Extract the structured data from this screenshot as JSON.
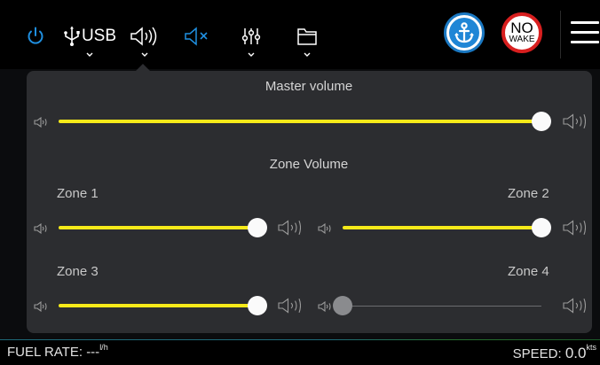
{
  "topbar": {
    "source_label": "USB",
    "colors": {
      "accent": "#1f8fe0",
      "icon": "#ffffff"
    }
  },
  "badges": {
    "anchor": {
      "icon": "anchor-icon",
      "color": "#1f86d6"
    },
    "no_wake": {
      "line1": "NO",
      "line2": "WAKE",
      "color": "#d81f1f"
    }
  },
  "panel": {
    "master": {
      "title": "Master volume",
      "level": 1.0
    },
    "zone_title": "Zone Volume",
    "zones": [
      {
        "label": "Zone 1",
        "level": 1.0
      },
      {
        "label": "Zone 2",
        "level": 1.0
      },
      {
        "label": "Zone 3",
        "level": 1.0
      },
      {
        "label": "Zone 4",
        "level": 0.0
      }
    ],
    "colors": {
      "track": "#f6ea19",
      "knob": "#fafafa",
      "inactive": "#6b6c70"
    }
  },
  "footer": {
    "fuel_label": "FUEL RATE: ",
    "fuel_value": "---",
    "fuel_unit": "l/h",
    "speed_label": "SPEED: ",
    "speed_value": "0.0",
    "speed_unit": "kts"
  }
}
